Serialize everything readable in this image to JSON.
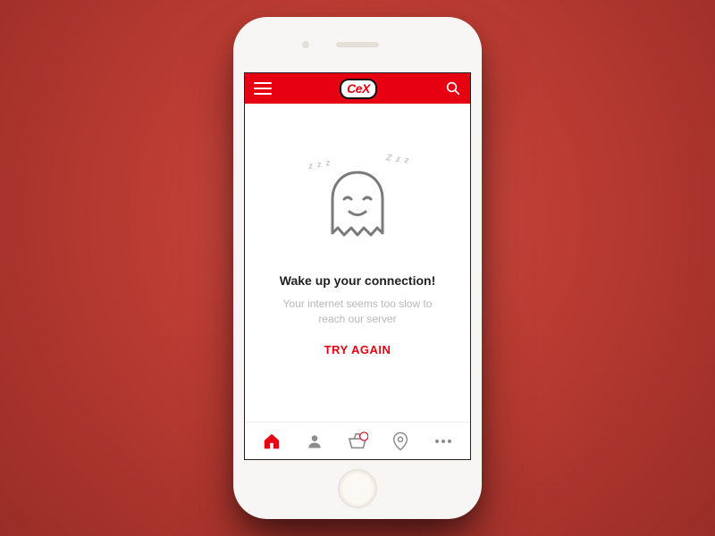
{
  "app": {
    "brand": "CeX"
  },
  "error": {
    "zz_left": "z z z",
    "zz_right": "Z z z",
    "headline": "Wake up your connection!",
    "subtext": "Your internet seems too slow to reach our server",
    "retry_label": "TRY AGAIN"
  },
  "tabs": {
    "home": "home",
    "profile": "profile",
    "basket": "basket",
    "location": "location",
    "more": "more"
  }
}
